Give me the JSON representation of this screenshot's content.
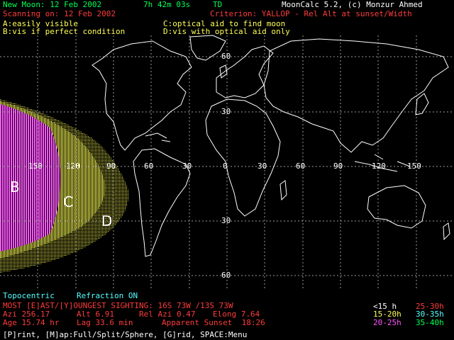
{
  "header": {
    "new_moon": "New Moon: 12 Feb 2002",
    "time": "7h 42m 03s",
    "td": "TD",
    "app_name": "MoonCalc 5.2, (c) Monzur Ahmed",
    "scanning": "Scanning on: 12 Feb 2002",
    "criterion": "Criterion: YALLOP - Rel Alt at sunset/Width"
  },
  "legend": {
    "a": "A:easily visible",
    "b": "B:vis if perfect condition",
    "c": "C:optical aid to find moon",
    "d": "D:vis with optical aid only"
  },
  "map": {
    "zone_labels": [
      "B",
      "C",
      "D"
    ],
    "lon_labels": [
      "150",
      "120",
      "90",
      "60",
      "30",
      "0",
      "30",
      "60",
      "90",
      "120",
      "150"
    ],
    "lat_labels": [
      "60",
      "30",
      "30",
      "60"
    ]
  },
  "footer": {
    "mode": "Topocentric",
    "refraction": "Refraction ON",
    "sighting": "MOST [E]AST/[Y]OUNGEST SIGHTING: 16S 73W /13S 73W",
    "azi": "Azi 256.17",
    "alt": "Alt 6.91",
    "rel_azi": "Rel Azi 0.47",
    "elong": "Elong 7.64",
    "age": "Age 15.74 hr",
    "lag": "Lag 33.6 min",
    "sunset": "Apparent Sunset  18:26",
    "commands": "[P]rint, [M]ap:Full/Split/Sphere, [G]rid, SPACE:Menu"
  },
  "age_key": [
    {
      "label": "<15 h",
      "color": "#ffffff"
    },
    {
      "label": "25-30h",
      "color": "#ff3b3b"
    },
    {
      "label": "15-20h",
      "color": "#ffff55"
    },
    {
      "label": "30-35h",
      "color": "#55ffff"
    },
    {
      "label": "20-25h",
      "color": "#ff55ff"
    },
    {
      "label": "35-40h",
      "color": "#00ff55"
    }
  ]
}
